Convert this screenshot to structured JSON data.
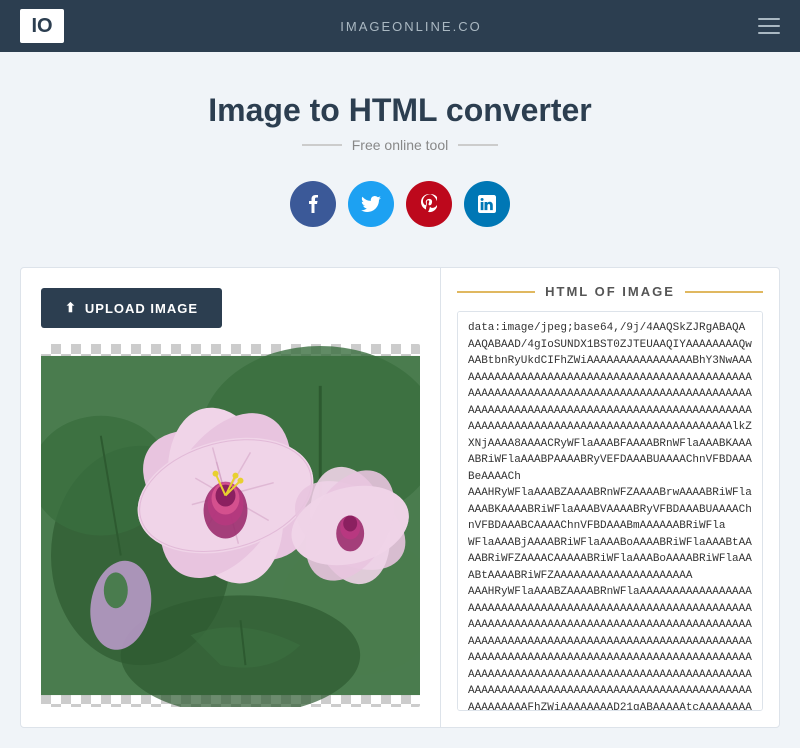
{
  "navbar": {
    "brand": "IO",
    "title": "IMAGEONLINE.CO"
  },
  "page": {
    "title": "Image to HTML converter",
    "subtitle": "Free online tool",
    "upload_btn": "UPLOAD IMAGE"
  },
  "social": [
    {
      "id": "facebook",
      "icon": "f",
      "class": "social-fb"
    },
    {
      "id": "twitter",
      "icon": "t",
      "class": "social-tw"
    },
    {
      "id": "pinterest",
      "icon": "p",
      "class": "social-pt"
    },
    {
      "id": "linkedin",
      "icon": "in",
      "class": "social-li"
    }
  ],
  "html_output": {
    "header": "HTML OF IMAGE",
    "content": "data:image/jpeg;base64,/9j/4AAQSkZJRgABAQAAAQABAAD/4gIoSUNDX1BST0ZJTEUAAQIYAAAAAAAQwAABtbnRyUkdCIFhZWiAAAAAAAAAAAAAAAABhY3NwAAAAAAAAAAAAAAAAAAAAAAAAAAAAAAAAAAABAAA3NwAAAAAAAAAAAAAAAAAAAAAAAAAAAAAAAAAAAAAAAAAAAAAAAAAAAAAAAAAAAAAAAAAAAAAAAAAAAAAAAAAAAAAAlkZXNjAAAA8AAAACRyWFlaAAABFAAAABRnWFlaAAABKAAAABRiWFlaAAABPAAAABRyVEFDAAABUAAAAChnVEFDAAABeAAAACh...AAAAAAAAAAAAAAAAAAAAAAAAAAAAAAAAAAAAAAAAAAAAAAAAAAAAAAAAAAAAAAAAAAAAAAAAAAAAAAAAAAAAAAAAAAAAAAAAAAAAAAAAAAAAAAAAAAAAAAAAAAAAAAAAAAAAAAAAAAAAAAAAAAAAAAAAAAAAAAAAAAAAAAAAAAAAAAAAAAAAAAAAAAAAAAAAAAAAAAAAAAAAAAAAAAAAAAAAAAAAAAAAAAAAAAAAAAAAAAAAAAAAAAAAAAAAAAAFhZWiAAAAAAAAD21gABAAAAAtcAAAAAAAAAAAAAAAAAAAAAAAAAAAAAAAAAAAAAAAAAAAAAAAAAAAAAAAAAAAAAAAAAAAAAAAAAAAAAAAAAAAAAAAAA"
  }
}
